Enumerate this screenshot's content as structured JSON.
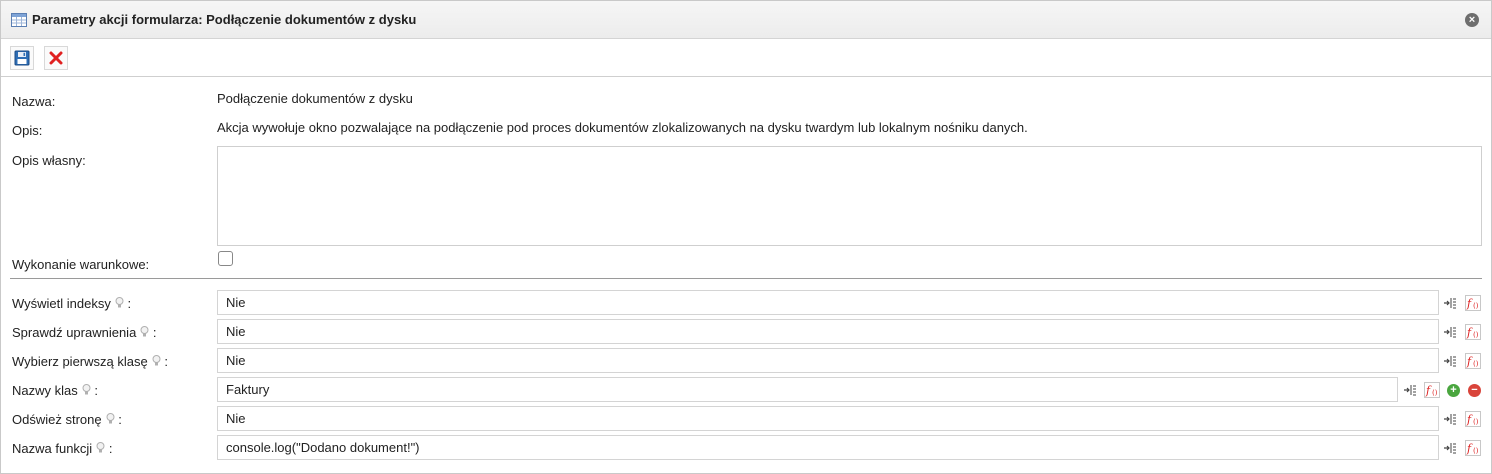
{
  "dialog": {
    "title": "Parametry akcji formularza: Podłączenie dokumentów z dysku"
  },
  "form": {
    "name_label": "Nazwa:",
    "name_value": "Podłączenie dokumentów z dysku",
    "desc_label": "Opis:",
    "desc_value": "Akcja wywołuje okno pozwalające na podłączenie pod proces dokumentów zlokalizowanych na dysku twardym lub lokalnym nośniku danych.",
    "own_desc_label": "Opis własny:",
    "own_desc_value": "",
    "conditional_label": "Wykonanie warunkowe:",
    "conditional_checked": false
  },
  "params": [
    {
      "label": "Wyświetl indeksy",
      "value": "Nie"
    },
    {
      "label": "Sprawdź uprawnienia",
      "value": "Nie"
    },
    {
      "label": "Wybierz pierwszą klasę",
      "value": "Nie"
    },
    {
      "label": "Nazwy klas",
      "value": "Faktury"
    },
    {
      "label": "Odśwież stronę",
      "value": "Nie"
    },
    {
      "label": "Nazwa funkcji",
      "value": "console.log(\"Dodano dokument!\")"
    }
  ],
  "colors": {
    "save": "#1f5fa8",
    "cancel": "#e02020",
    "add": "#4aa63f",
    "remove": "#d9443a"
  }
}
